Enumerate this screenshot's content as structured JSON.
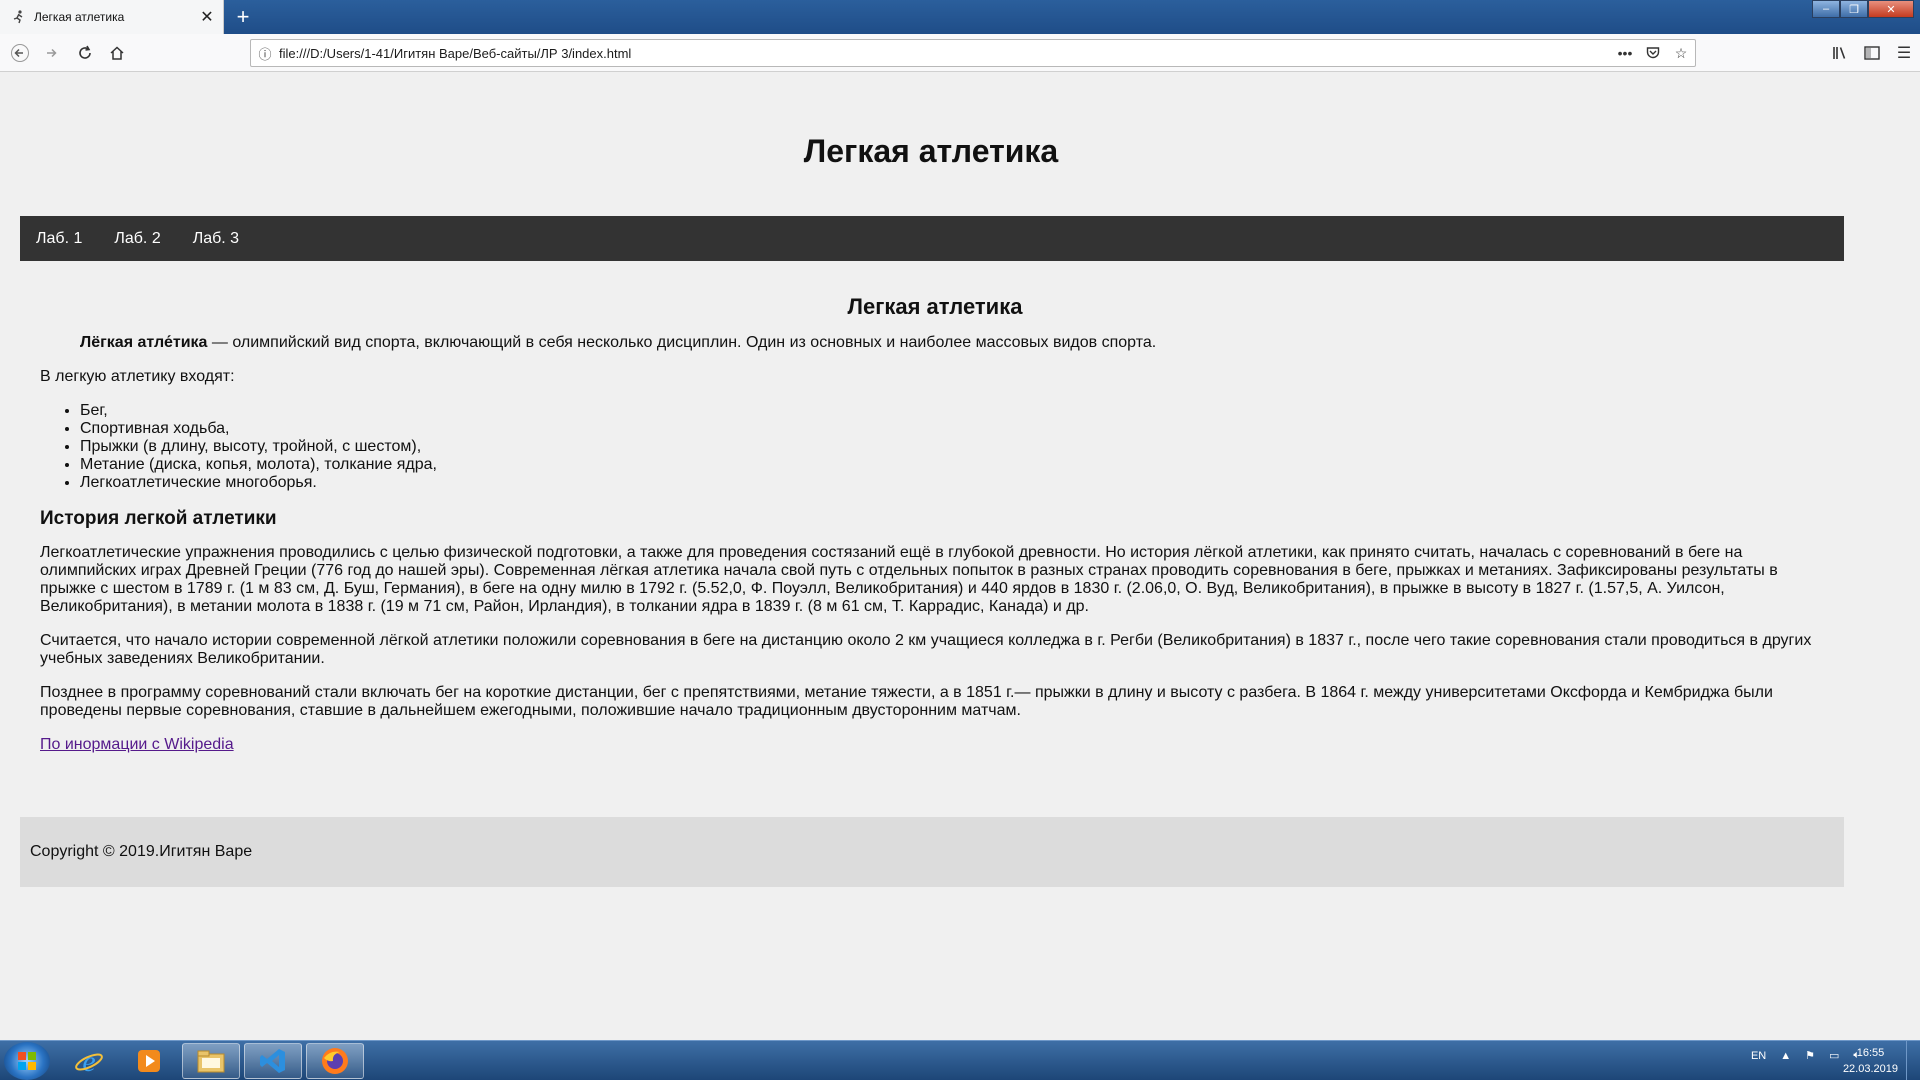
{
  "browser": {
    "tab_title": "Легкая атлетика",
    "tab_icon": "runner-icon",
    "url": "file:///D:/Users/1-41/Игитян Варе/Веб-сайты/ЛР 3/index.html"
  },
  "page": {
    "site_title": "Легкая атлетика",
    "menu": [
      "Лаб. 1",
      "Лаб. 2",
      "Лаб. 3"
    ],
    "article_title": "Легкая атлетика",
    "lead_bold": "Лёгкая атле́тика",
    "lead_rest": " — олимпийский вид спорта, включающий в себя несколько дисциплин. Один из основных и наиболее массовых видов спорта.",
    "includes_intro": "В легкую атлетику входят:",
    "disciplines": [
      "Бег,",
      "Спортивная ходьба,",
      "Прыжки (в длину, высоту, тройной, с шестом),",
      "Метание (диска, копья, молота), толкание ядра,",
      "Легкоатлетические многоборья."
    ],
    "history_title": "История легкой атлетики",
    "history_p1": "Легкоатлетические упражнения проводились с целью физической подготовки, а также для проведения состязаний ещё в глубокой древности. Но история лёгкой атлетики, как принято считать, началась с соревнований в беге на олимпийских играх Древней Греции (776 год до нашей эры). Современная лёгкая атлетика начала свой путь с отдельных попыток в разных странах проводить соревнования в беге, прыжках и метаниях. Зафиксированы результаты в прыжке с шестом в 1789 г. (1 м 83 см, Д. Буш, Германия), в беге на одну милю в 1792 г. (5.52,0, Ф. Поуэлл, Великобритания) и 440 ярдов в 1830 г. (2.06,0, О. Вуд, Великобритания), в прыжке в высоту в 1827 г. (1.57,5, А. Уилсон, Великобритания), в метании молота в 1838 г. (19 м 71 см, Район, Ирландия), в толкании ядра в 1839 г. (8 м 61 см, Т. Каррадис, Канада) и др.",
    "history_p2": "Считается, что начало истории современной лёгкой атлетики положили соревнования в беге на дистанцию около 2 км учащиеся колледжа в г. Регби (Великобритания) в 1837 г., после чего такие соревнования стали проводиться в других учебных заведениях Великобритании.",
    "history_p3": "Позднее в программу соревнований стали включать бег на короткие дистанции, бег с препятствиями, метание тяжести, а в 1851 г.— прыжки в длину и высоту с разбега. В 1864 г. между университетами Оксфорда и Кембриджа были проведены первые соревнования, ставшие в дальнейшем ежегодными, положившие начало традиционным двусторонним матчам.",
    "source_link": "По инормации с Wikipedia",
    "footer": "Copyright © 2019.Игитян Варе"
  },
  "taskbar": {
    "lang": "EN",
    "time": "16:55",
    "date": "22.03.2019"
  }
}
